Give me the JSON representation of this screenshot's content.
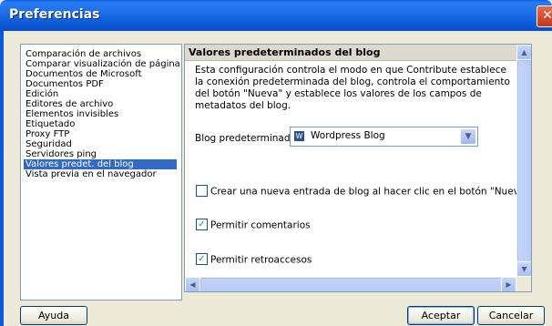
{
  "window": {
    "title": "Preferencias",
    "close_glyph": "✕"
  },
  "categories": [
    "Comparación de archivos",
    "Comparar visualización de página",
    "Documentos de Microsoft",
    "Documentos PDF",
    "Edición",
    "Editores de archivo",
    "Elementos invisibles",
    "Etiquetado",
    "Proxy FTP",
    "Seguridad",
    "Servidores ping",
    "Valores predet. del blog",
    "Vista previa en el navegador"
  ],
  "selected_category_index": 11,
  "panel": {
    "header": "Valores predeterminados del blog",
    "description": "Esta configuración controla el modo en que Contribute establece la conexión predeterminada del blog, controla el comportamiento del botón \"Nueva\" y establece los valores de los campos de metadatos del blog.",
    "default_blog_label": "Blog predeterminado:",
    "default_blog_value": "Wordpress Blog",
    "checkboxes": [
      {
        "label": "Crear una nueva entrada de blog al hacer clic en el botón \"Nueva\"",
        "checked": false
      },
      {
        "label": "Permitir comentarios",
        "checked": true
      },
      {
        "label": "Permitir retroaccesos",
        "checked": true
      }
    ]
  },
  "buttons": {
    "help": "Ayuda",
    "ok": "Aceptar",
    "cancel": "Cancelar"
  },
  "icons": {
    "blog_icon": "wordpress-icon",
    "checkmark": "✓",
    "up": "▲",
    "down": "▼",
    "left": "◀",
    "right": "▶",
    "dropdown": "▼"
  }
}
